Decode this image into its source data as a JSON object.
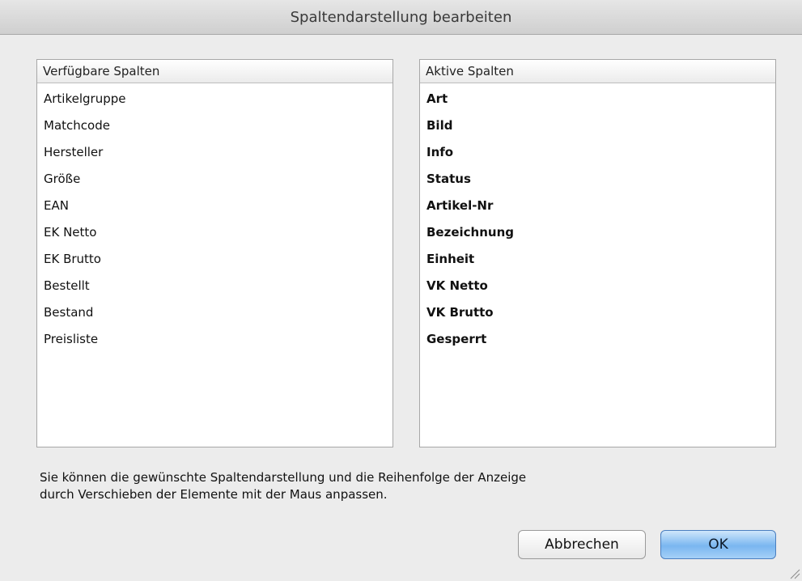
{
  "window": {
    "title": "Spaltendarstellung bearbeiten"
  },
  "available": {
    "header": "Verfügbare Spalten",
    "items": [
      "Artikelgruppe",
      "Matchcode",
      "Hersteller",
      "Größe",
      "EAN",
      "EK Netto",
      "EK Brutto",
      "Bestellt",
      "Bestand",
      "Preisliste"
    ]
  },
  "active": {
    "header": "Aktive Spalten",
    "items": [
      "Art",
      "Bild",
      "Info",
      "Status",
      "Artikel-Nr",
      "Bezeichnung",
      "Einheit",
      "VK Netto",
      "VK Brutto",
      "Gesperrt"
    ]
  },
  "hint": {
    "line1": "Sie können die gewünschte Spaltendarstellung und die Reihenfolge der Anzeige",
    "line2": "durch Verschieben der Elemente mit der Maus anpassen."
  },
  "buttons": {
    "cancel": "Abbrechen",
    "ok": "OK"
  },
  "colors": {
    "window_bg": "#ececec",
    "ok_accent": "#7ab6f0"
  },
  "icons": {
    "resize": "resize-grip-icon"
  }
}
